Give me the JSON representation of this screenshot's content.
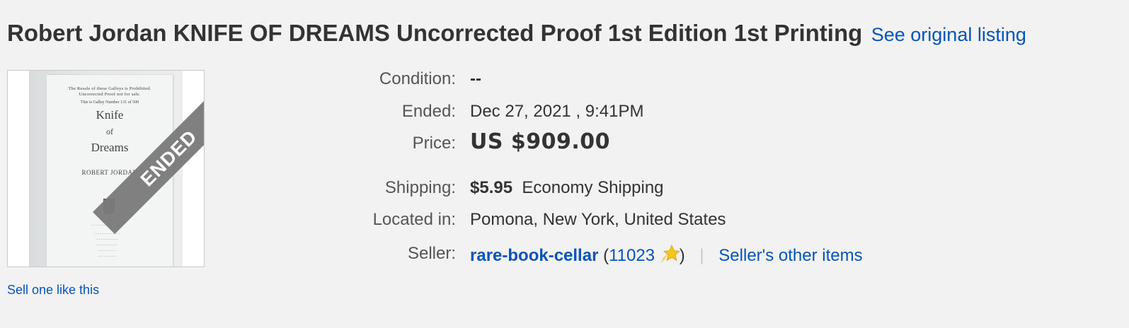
{
  "listing": {
    "title": "Robert Jordan KNIFE OF DREAMS Uncorrected Proof 1st Edition 1st Printing",
    "see_original": "See original listing",
    "sell_one": "Sell one like this"
  },
  "image": {
    "book_notice_1": "The Resale of these Galleys is Prohibited.",
    "book_notice_2": "Uncorrected Proof not for sale.",
    "book_gallery": "This is Galley Number 131 of 500",
    "book_title_1": "Knife",
    "book_title_2": "of",
    "book_title_3": "Dreams",
    "book_author": "ROBERT JORDAN",
    "ended_badge": "ENDED"
  },
  "details": {
    "condition_label": "Condition:",
    "condition_value": "--",
    "ended_label": "Ended:",
    "ended_value": "Dec 27, 2021 , 9:41PM",
    "price_label": "Price:",
    "price_value": "US $909.00",
    "shipping_label": "Shipping:",
    "shipping_price": "$5.95",
    "shipping_method": "Economy Shipping",
    "location_label": "Located in:",
    "location_value": "Pomona, New York, United States",
    "seller_label": "Seller:",
    "seller_name": "rare-book-cellar",
    "seller_feedback_open": "(",
    "seller_feedback": "11023",
    "seller_feedback_close": ")",
    "separator": "|",
    "other_items": "Seller's other items"
  },
  "colors": {
    "link": "#0654ba",
    "background": "#f2f2f2",
    "ended_band": "#7a7a7a",
    "star": "#f5c518"
  },
  "icons": {
    "feedback_star": "yellow-shooting-star-icon"
  }
}
